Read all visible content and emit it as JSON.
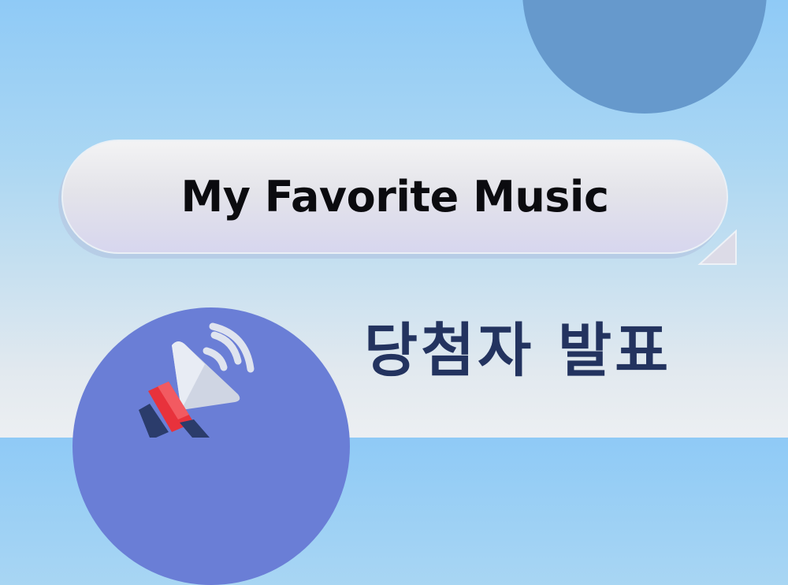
{
  "bubble": {
    "title": "My Favorite Music"
  },
  "announcement": {
    "text": "당첨자 발표"
  },
  "icons": {
    "megaphone": "megaphone-icon"
  },
  "colors": {
    "background_top": "#8fcaf6",
    "background_bottom": "#eceff2",
    "circle_top": "#6699cc",
    "circle_bottom": "#6a7ed6",
    "title_text": "#0b0b0f",
    "announcement_text": "#23335f",
    "megaphone_red": "#e8323c",
    "megaphone_navy": "#2b3c6b",
    "megaphone_light": "#dfe4ef"
  }
}
